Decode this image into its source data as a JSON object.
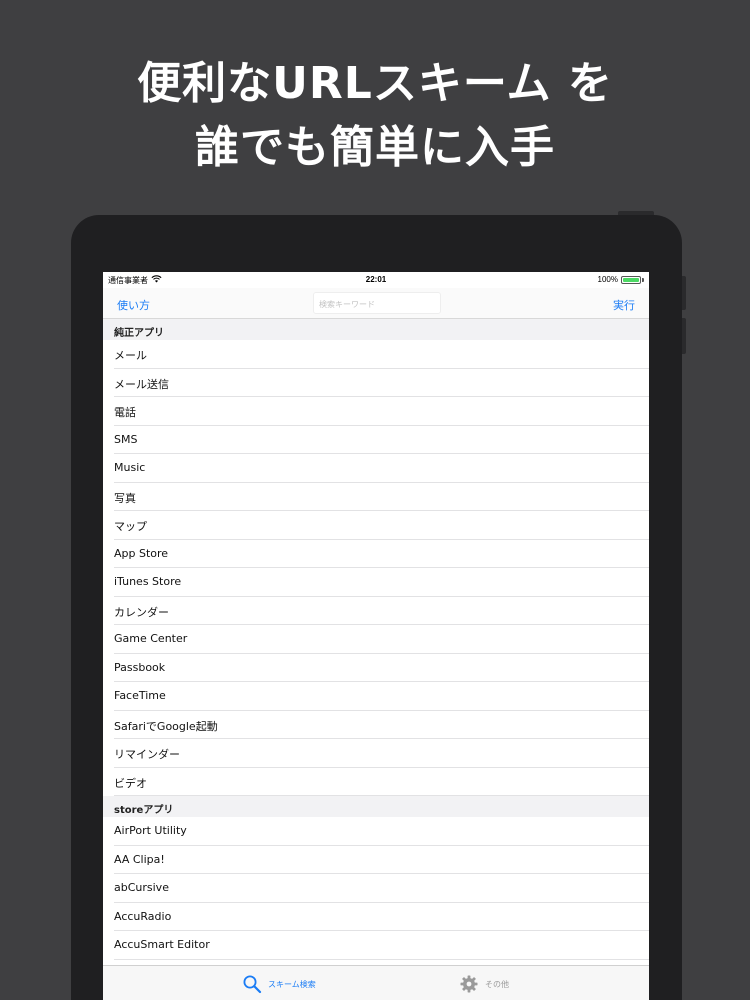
{
  "headline": {
    "line1": "便利なURLスキーム を",
    "line2": "誰でも簡単に入手"
  },
  "statusbar": {
    "carrier": "通信事業者",
    "time": "22:01",
    "battery": "100%",
    "battery_level": 1.0
  },
  "navbar": {
    "left": "使い方",
    "search_placeholder": "検索キーワード",
    "right": "実行"
  },
  "sections": [
    {
      "header": "純正アプリ",
      "items": [
        "メール",
        "メール送信",
        "電話",
        "SMS",
        "Music",
        "写真",
        "マップ",
        "App Store",
        "iTunes Store",
        "カレンダー",
        "Game Center",
        "Passbook",
        "FaceTime",
        "SafariでGoogle起動",
        "リマインダー",
        "ビデオ"
      ]
    },
    {
      "header": "storeアプリ",
      "items": [
        "AirPort Utility",
        "AA Clipa!",
        "abCursive",
        "AccuRadio",
        "AccuSmart Editor"
      ]
    }
  ],
  "tabbar": {
    "search_label": "スキーム検索",
    "other_label": "その他",
    "search_icon": "search-icon",
    "other_icon": "gear-icon"
  },
  "colors": {
    "accent": "#1a7cf5",
    "background": "#3f3f41",
    "device": "#1f1f21"
  }
}
